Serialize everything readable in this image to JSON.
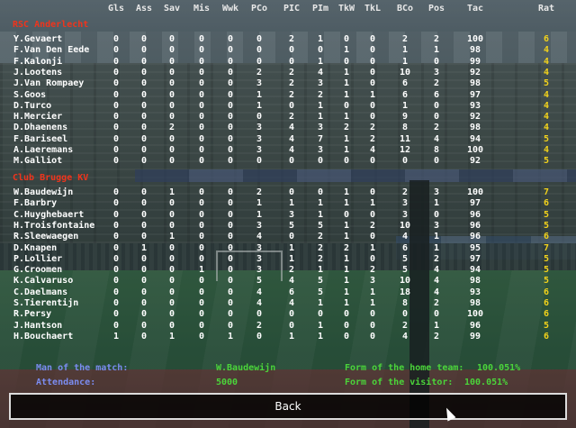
{
  "columns": [
    "Gls",
    "Ass",
    "Sav",
    "Mis",
    "Wwk",
    "PCo",
    "PIC",
    "PIm",
    "TkW",
    "TkL",
    "BCo",
    "Pos",
    "Tac",
    "Rat"
  ],
  "teams": [
    {
      "name": "RSC Anderlecht",
      "players": [
        {
          "name": "Y.Gevaert",
          "stats": [
            "0",
            "0",
            "0",
            "0",
            "0",
            "0",
            "2",
            "1",
            "0",
            "0",
            "2",
            "2",
            "100"
          ],
          "rat": "6"
        },
        {
          "name": "F.Van Den Eede",
          "stats": [
            "0",
            "0",
            "0",
            "0",
            "0",
            "0",
            "0",
            "0",
            "1",
            "0",
            "1",
            "1",
            "98"
          ],
          "rat": "4"
        },
        {
          "name": "F.Kalonji",
          "stats": [
            "0",
            "0",
            "0",
            "0",
            "0",
            "0",
            "0",
            "1",
            "0",
            "0",
            "1",
            "0",
            "99"
          ],
          "rat": "4"
        },
        {
          "name": "J.Lootens",
          "stats": [
            "0",
            "0",
            "0",
            "0",
            "0",
            "2",
            "2",
            "4",
            "1",
            "0",
            "10",
            "3",
            "92"
          ],
          "rat": "4"
        },
        {
          "name": "J.Van Rompaey",
          "stats": [
            "0",
            "0",
            "0",
            "0",
            "0",
            "3",
            "2",
            "3",
            "1",
            "0",
            "6",
            "2",
            "98"
          ],
          "rat": "5"
        },
        {
          "name": "S.Goos",
          "stats": [
            "0",
            "0",
            "0",
            "0",
            "0",
            "1",
            "2",
            "2",
            "1",
            "1",
            "6",
            "6",
            "97"
          ],
          "rat": "4"
        },
        {
          "name": "D.Turco",
          "stats": [
            "0",
            "0",
            "0",
            "0",
            "0",
            "1",
            "0",
            "1",
            "0",
            "0",
            "1",
            "0",
            "93"
          ],
          "rat": "4"
        },
        {
          "name": "H.Mercier",
          "stats": [
            "0",
            "0",
            "0",
            "0",
            "0",
            "0",
            "2",
            "1",
            "1",
            "0",
            "9",
            "0",
            "92"
          ],
          "rat": "4"
        },
        {
          "name": "D.Dhaenens",
          "stats": [
            "0",
            "0",
            "2",
            "0",
            "0",
            "3",
            "4",
            "3",
            "2",
            "2",
            "8",
            "2",
            "98"
          ],
          "rat": "4"
        },
        {
          "name": "F.Bariseel",
          "stats": [
            "0",
            "0",
            "0",
            "0",
            "0",
            "3",
            "4",
            "7",
            "1",
            "2",
            "11",
            "4",
            "94"
          ],
          "rat": "5"
        },
        {
          "name": "A.Laeremans",
          "stats": [
            "0",
            "0",
            "0",
            "0",
            "0",
            "3",
            "4",
            "3",
            "1",
            "4",
            "12",
            "8",
            "100"
          ],
          "rat": "4"
        },
        {
          "name": "M.Galliot",
          "stats": [
            "0",
            "0",
            "0",
            "0",
            "0",
            "0",
            "0",
            "0",
            "0",
            "0",
            "0",
            "0",
            "92"
          ],
          "rat": "5"
        }
      ]
    },
    {
      "name": "Club Brugge KV",
      "players": [
        {
          "name": "W.Baudewijn",
          "stats": [
            "0",
            "0",
            "1",
            "0",
            "0",
            "2",
            "0",
            "0",
            "1",
            "0",
            "2",
            "3",
            "100"
          ],
          "rat": "7"
        },
        {
          "name": "F.Barbry",
          "stats": [
            "0",
            "0",
            "0",
            "0",
            "0",
            "1",
            "1",
            "1",
            "1",
            "1",
            "3",
            "1",
            "97"
          ],
          "rat": "6"
        },
        {
          "name": "C.Huyghebaert",
          "stats": [
            "0",
            "0",
            "0",
            "0",
            "0",
            "1",
            "3",
            "1",
            "0",
            "0",
            "3",
            "0",
            "96"
          ],
          "rat": "5"
        },
        {
          "name": "H.Troisfontaine",
          "stats": [
            "0",
            "0",
            "0",
            "0",
            "0",
            "3",
            "5",
            "5",
            "1",
            "2",
            "10",
            "3",
            "96"
          ],
          "rat": "5"
        },
        {
          "name": "R.Sleewaegen",
          "stats": [
            "0",
            "0",
            "1",
            "0",
            "0",
            "4",
            "0",
            "2",
            "1",
            "0",
            "4",
            "1",
            "96"
          ],
          "rat": "6"
        },
        {
          "name": "D.Knapen",
          "stats": [
            "0",
            "1",
            "0",
            "0",
            "0",
            "3",
            "1",
            "2",
            "2",
            "1",
            "6",
            "1",
            "95"
          ],
          "rat": "7"
        },
        {
          "name": "P.Lollier",
          "stats": [
            "0",
            "0",
            "0",
            "0",
            "0",
            "3",
            "1",
            "2",
            "1",
            "0",
            "5",
            "2",
            "97"
          ],
          "rat": "5"
        },
        {
          "name": "G.Croomen",
          "stats": [
            "0",
            "0",
            "0",
            "1",
            "0",
            "3",
            "2",
            "1",
            "1",
            "2",
            "5",
            "4",
            "94"
          ],
          "rat": "5"
        },
        {
          "name": "K.Calvaruso",
          "stats": [
            "0",
            "0",
            "0",
            "0",
            "0",
            "5",
            "4",
            "5",
            "1",
            "3",
            "10",
            "4",
            "98"
          ],
          "rat": "5"
        },
        {
          "name": "C.Daelmans",
          "stats": [
            "0",
            "0",
            "0",
            "0",
            "0",
            "4",
            "6",
            "5",
            "1",
            "1",
            "18",
            "4",
            "93"
          ],
          "rat": "6"
        },
        {
          "name": "S.Tierentijn",
          "stats": [
            "0",
            "0",
            "0",
            "0",
            "0",
            "4",
            "4",
            "1",
            "1",
            "1",
            "8",
            "2",
            "98"
          ],
          "rat": "6"
        },
        {
          "name": "R.Persy",
          "stats": [
            "0",
            "0",
            "0",
            "0",
            "0",
            "0",
            "0",
            "0",
            "0",
            "0",
            "0",
            "0",
            "100"
          ],
          "rat": "6"
        },
        {
          "name": "J.Hantson",
          "stats": [
            "0",
            "0",
            "0",
            "0",
            "0",
            "2",
            "0",
            "1",
            "0",
            "0",
            "2",
            "1",
            "96"
          ],
          "rat": "5"
        },
        {
          "name": "H.Bouchaert",
          "stats": [
            "1",
            "0",
            "1",
            "0",
            "1",
            "0",
            "1",
            "1",
            "0",
            "0",
            "4",
            "2",
            "99"
          ],
          "rat": "6"
        }
      ]
    }
  ],
  "footer": {
    "motm_label": "Man of the match:",
    "motm_value": "W.Baudewijn",
    "attendance_label": "Attendance:",
    "attendance_value": "5000",
    "home_form_label": "Form of the home team:",
    "home_form_value": "100.051%",
    "visitor_form_label": "Form of the visitor:",
    "visitor_form_value": "100.051%"
  },
  "back_label": "Back",
  "colors": {
    "team_name": "#f0341c",
    "rating": "#f2d21b",
    "label": "#7b8cf0",
    "value": "#4bd43a"
  }
}
